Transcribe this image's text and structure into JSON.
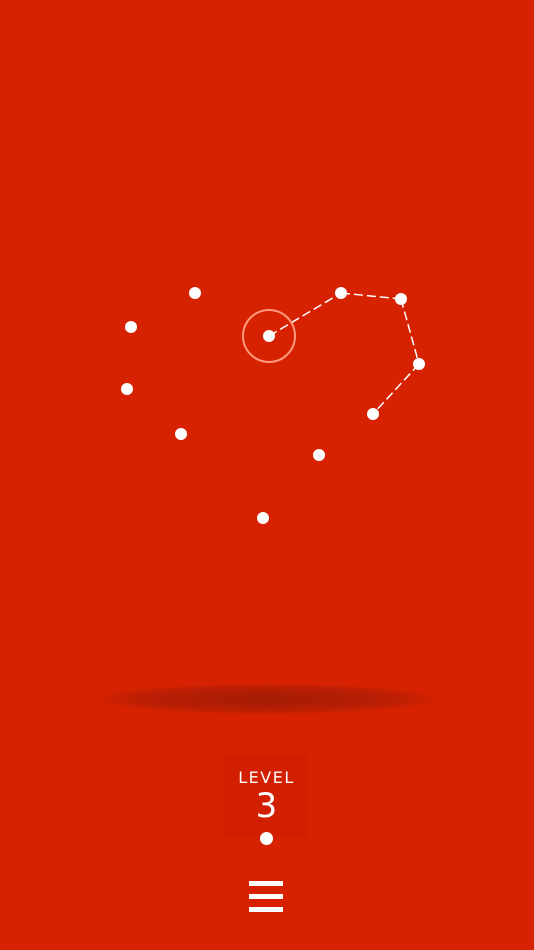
{
  "game": {
    "background_color": "#d62200",
    "dot_color": "#ffffff",
    "selection_ring_color": "#ff9a80"
  },
  "level": {
    "label": "LEVEL",
    "number": "3"
  },
  "menu": {
    "icon": "hamburger-menu-icon"
  }
}
